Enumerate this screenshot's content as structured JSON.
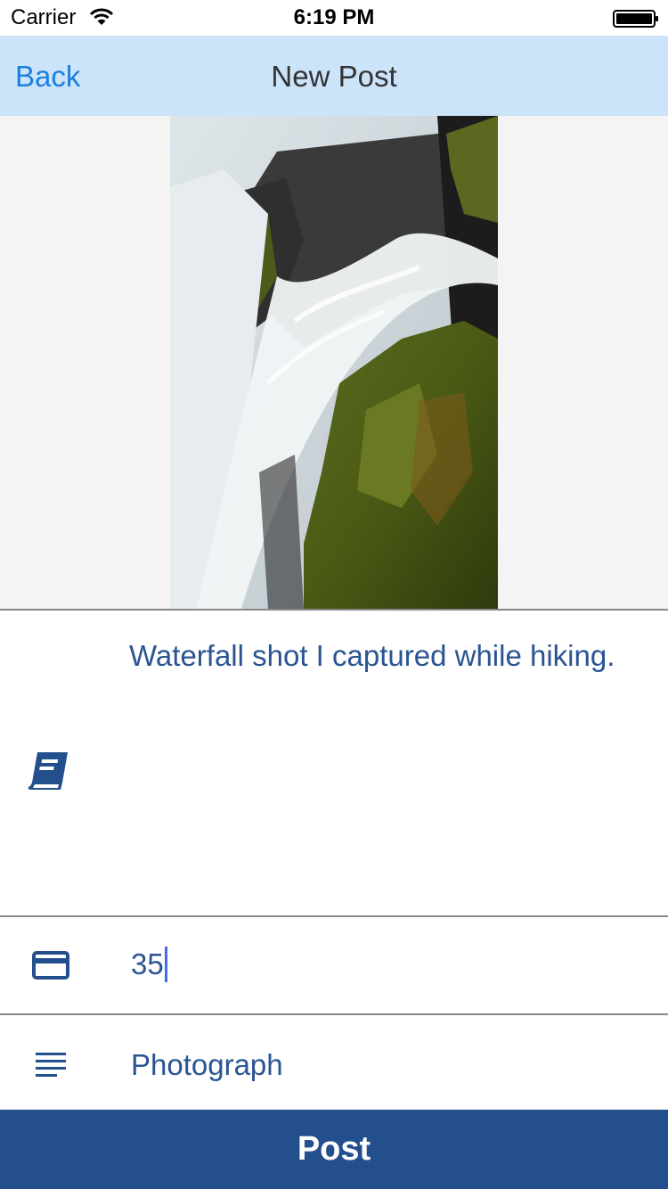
{
  "status_bar": {
    "carrier": "Carrier",
    "time": "6:19 PM",
    "icons": [
      "wifi-icon",
      "battery-icon"
    ]
  },
  "nav": {
    "back_label": "Back",
    "title": "New Post"
  },
  "form": {
    "description": "Waterfall shot I captured while hiking.",
    "description_icon": "book-icon",
    "price_value": "35",
    "price_icon": "credit-card-icon",
    "category_value": "Photograph",
    "category_icon": "lines-icon"
  },
  "post_button_label": "Post",
  "colors": {
    "nav_background": "#cce4fa",
    "accent_blue": "#1a7fe0",
    "text_blue": "#2a5592",
    "button_background": "#23508c"
  }
}
